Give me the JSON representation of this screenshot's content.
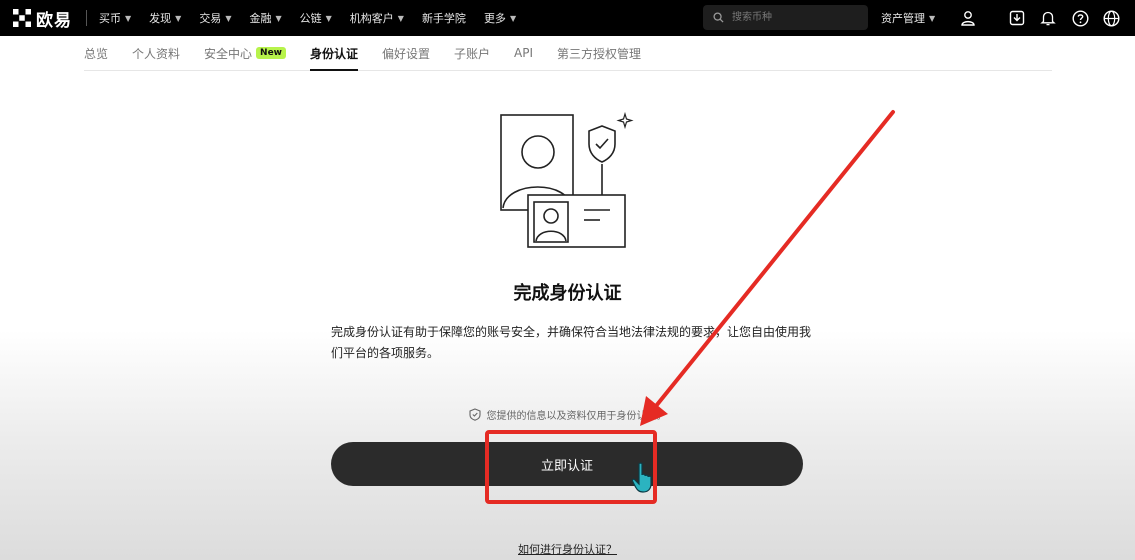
{
  "brand": {
    "name": "欧易"
  },
  "nav": {
    "items": [
      {
        "label": "买币",
        "dropdown": true
      },
      {
        "label": "发现",
        "dropdown": true
      },
      {
        "label": "交易",
        "dropdown": true
      },
      {
        "label": "金融",
        "dropdown": true
      },
      {
        "label": "公链",
        "dropdown": true
      },
      {
        "label": "机构客户",
        "dropdown": true
      },
      {
        "label": "新手学院",
        "dropdown": false
      },
      {
        "label": "更多",
        "dropdown": true
      }
    ],
    "search_placeholder": "搜索币种",
    "assets_label": "资产管理",
    "icons": [
      "user-icon",
      "download-icon",
      "bell-icon",
      "help-icon",
      "globe-icon"
    ]
  },
  "tabs": [
    {
      "label": "总览"
    },
    {
      "label": "个人资料"
    },
    {
      "label": "安全中心",
      "badge": "New"
    },
    {
      "label": "身份认证",
      "active": true
    },
    {
      "label": "偏好设置"
    },
    {
      "label": "子账户"
    },
    {
      "label": "API"
    },
    {
      "label": "第三方授权管理"
    }
  ],
  "main": {
    "title": "完成身份认证",
    "description": "完成身份认证有助于保障您的账号安全，并确保符合当地法律法规的要求，让您自由使用我们平台的各项服务。",
    "privacy_note": "您提供的信息以及资料仅用于身份认证。",
    "verify_button": "立即认证",
    "help_link": "如何进行身份认证？"
  },
  "colors": {
    "nav_bg": "#000000",
    "badge_bg": "#b7f34b",
    "button_bg": "#2b2b2b",
    "annotation_red": "#e52b24"
  }
}
